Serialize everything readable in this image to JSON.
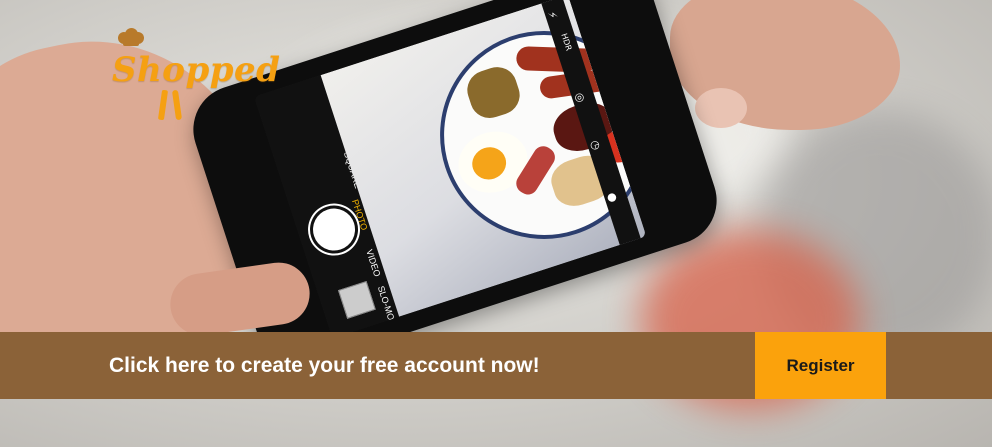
{
  "brand": {
    "logo_text": "Shopped",
    "color": "#f5a012"
  },
  "hero": {
    "image_alt": "Hand holding a phone photographing a breakfast plate",
    "camera_modes": [
      "SQUARE",
      "PHOTO",
      "VIDEO",
      "SLO-MO"
    ],
    "active_mode": "PHOTO",
    "camera_icons": {
      "hdr": "HDR",
      "flash": "flash-off-icon",
      "live": "live-photo-icon",
      "timer": "timer-icon",
      "filter": "filter-icon"
    }
  },
  "cta": {
    "message": "Click here to create your free account now!",
    "button_label": "Register",
    "bar_color": "#8b6238",
    "button_color": "#fba20c"
  }
}
